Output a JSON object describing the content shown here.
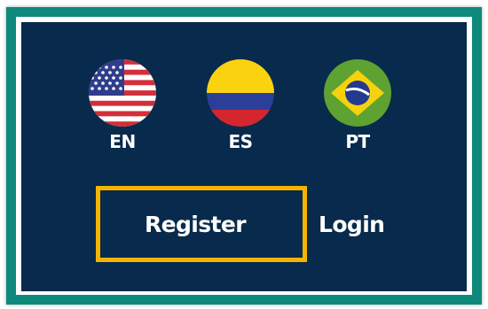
{
  "languages": [
    {
      "code": "EN",
      "flag": "us-flag-icon"
    },
    {
      "code": "ES",
      "flag": "colombia-flag-icon"
    },
    {
      "code": "PT",
      "flag": "brazil-flag-icon"
    }
  ],
  "auth": {
    "register_label": "Register",
    "login_label": "Login"
  },
  "colors": {
    "frame_border": "#0e8a7c",
    "panel_background": "#082a4c",
    "highlight_box": "#f5b400",
    "text": "#ffffff"
  }
}
